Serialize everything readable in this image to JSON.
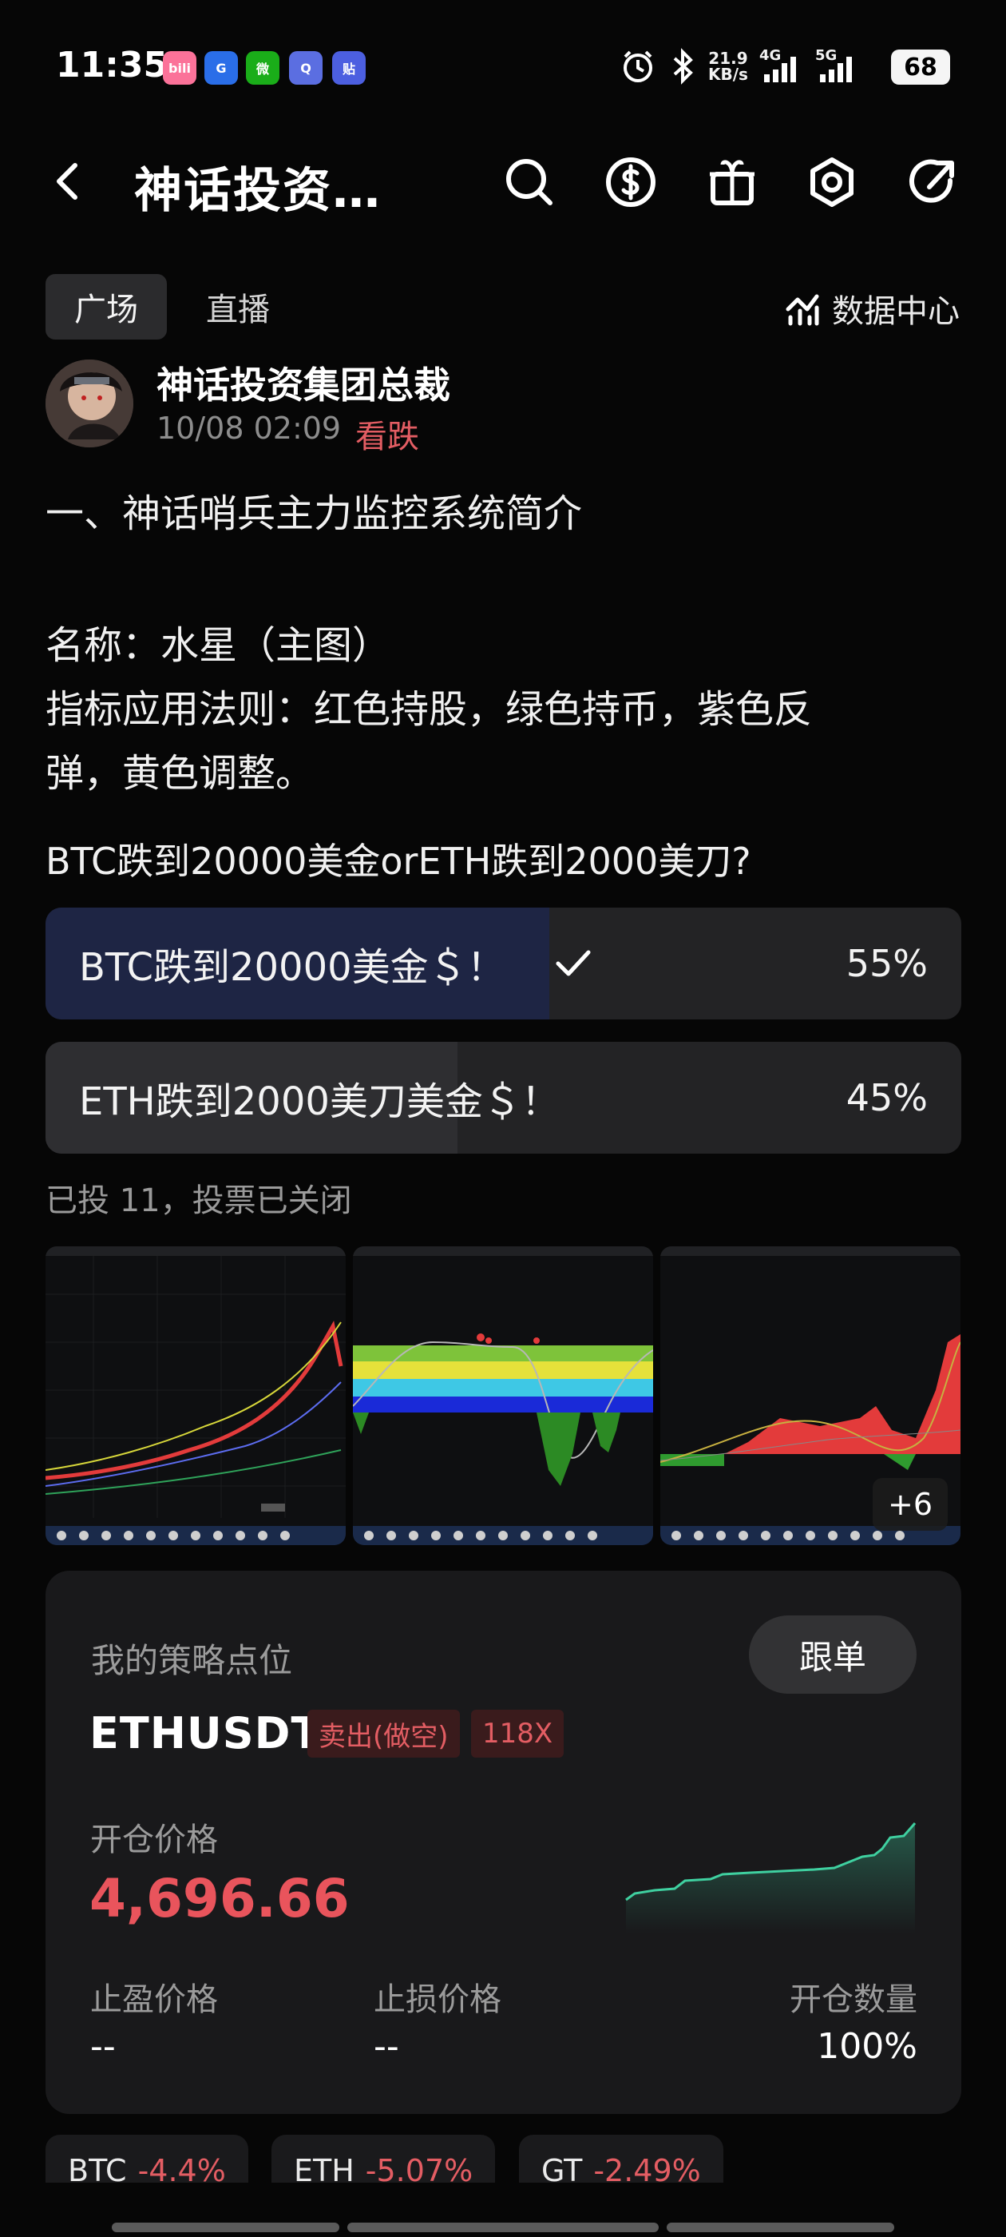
{
  "status_bar": {
    "time": "11:35",
    "apps": [
      {
        "name": "bilibili-icon",
        "text": "bili",
        "color": "#fb7299"
      },
      {
        "name": "browser-icon",
        "text": "G",
        "color": "#2a6ee8"
      },
      {
        "name": "wechat-icon",
        "text": "微",
        "color": "#1aad19"
      },
      {
        "name": "app-q-icon",
        "text": "Q",
        "color": "#5b6ee1"
      },
      {
        "name": "tieba-icon",
        "text": "贴",
        "color": "#4c5fe0"
      }
    ],
    "net_speed": "21.9",
    "net_unit": "KB/s",
    "sig1": "4G",
    "sig2": "5G",
    "battery": "68"
  },
  "header": {
    "title": "神话投资…",
    "icons": [
      "search-icon",
      "dollar-icon",
      "gift-icon",
      "settings-icon",
      "share-icon"
    ]
  },
  "tabs": {
    "square": "广场",
    "live": "直播",
    "data_center": "数据中心"
  },
  "post": {
    "author": "神话投资集团总裁",
    "time": "10/08 02:09",
    "sentiment": "看跌",
    "lines": [
      "一、神话哨兵主力监控系统简介",
      "名称：水星（主图）",
      "指标应用法则：红色持股，绿色持币，紫色反",
      "弹，黄色调整。"
    ]
  },
  "poll": {
    "question": "BTC跌到20000美金orETH跌到2000美刀?",
    "options": [
      {
        "label": "BTC跌到20000美金＄！",
        "pct": "55%",
        "share": 0.55,
        "selected": true
      },
      {
        "label": "ETH跌到2000美刀美金＄！",
        "pct": "45%",
        "share": 0.45,
        "selected": false
      }
    ],
    "meta": "已投 11，投票已关闭"
  },
  "images": {
    "more": "+6"
  },
  "strategy": {
    "title": "我的策略点位",
    "follow": "跟单",
    "symbol": "ETHUSDT",
    "side": "卖出(做空)",
    "leverage": "118X",
    "open_label": "开仓价格",
    "open_price": "4,696.66",
    "tp_label": "止盈价格",
    "tp_value": "--",
    "sl_label": "止损价格",
    "sl_value": "--",
    "qty_label": "开仓数量",
    "qty_value": "100%",
    "accent_up": "#3fd0a0",
    "accent_down": "#e9545c"
  },
  "tickers": [
    {
      "sym": "BTC",
      "chg": "-4.4%"
    },
    {
      "sym": "ETH",
      "chg": "-5.07%"
    },
    {
      "sym": "GT",
      "chg": "-2.49%"
    }
  ]
}
